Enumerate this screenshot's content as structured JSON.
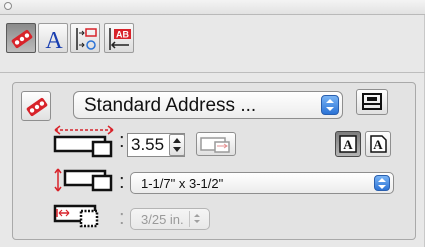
{
  "toolbar": {
    "tools": [
      {
        "icon": "label-ribbon-icon",
        "active": true
      },
      {
        "icon": "text-a-icon",
        "active": false
      },
      {
        "icon": "distribute-icon",
        "active": false
      },
      {
        "icon": "align-ab-icon",
        "active": false
      }
    ]
  },
  "label_panel": {
    "template_popup": {
      "value": "Standard Address ..."
    },
    "width_field": {
      "value": "3.55"
    },
    "size_popup": {
      "value": "1-1/7\" x 3-1/2\""
    },
    "margin_popup": {
      "value": "3/25 in."
    },
    "colon": ":"
  },
  "colors": {
    "accent_red": "#d8232a",
    "popup_blue": "#2b73d6"
  }
}
